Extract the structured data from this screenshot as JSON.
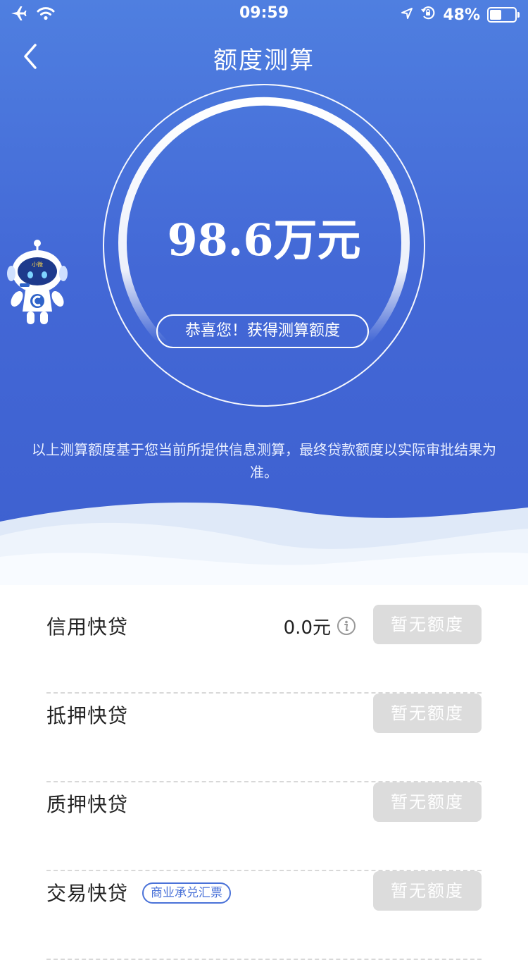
{
  "status_bar": {
    "time": "09:59",
    "battery_percent": "48%",
    "battery_level": 0.48,
    "icons": [
      "airplane-icon",
      "wifi-icon",
      "location-arrow-icon",
      "orientation-lock-icon",
      "battery-icon"
    ]
  },
  "header": {
    "title": "额度测算",
    "back_icon": "chevron-left-icon"
  },
  "result": {
    "amount": "98.6万元",
    "congrats": "恭喜您！获得测算额度"
  },
  "mascot": {
    "badge_text": "小微"
  },
  "notice": "以上测算额度基于您当前所提供信息测算，最终贷款额度以实际审批结果为准。",
  "loan_items": [
    {
      "label": "信用快贷",
      "amount": "0.0元",
      "button": "暂无额度",
      "has_info": true
    },
    {
      "label": "抵押快贷",
      "button": "暂无额度"
    },
    {
      "label": "质押快贷",
      "button": "暂无额度"
    },
    {
      "label": "交易快贷",
      "tag": "商业承兑汇票",
      "button": "暂无额度"
    }
  ],
  "colors": {
    "hero_top": "#4f7fe0",
    "hero_bottom": "#3d5fcf",
    "button_disabled": "#dcdcdc",
    "tag_blue": "#4a72d8"
  }
}
